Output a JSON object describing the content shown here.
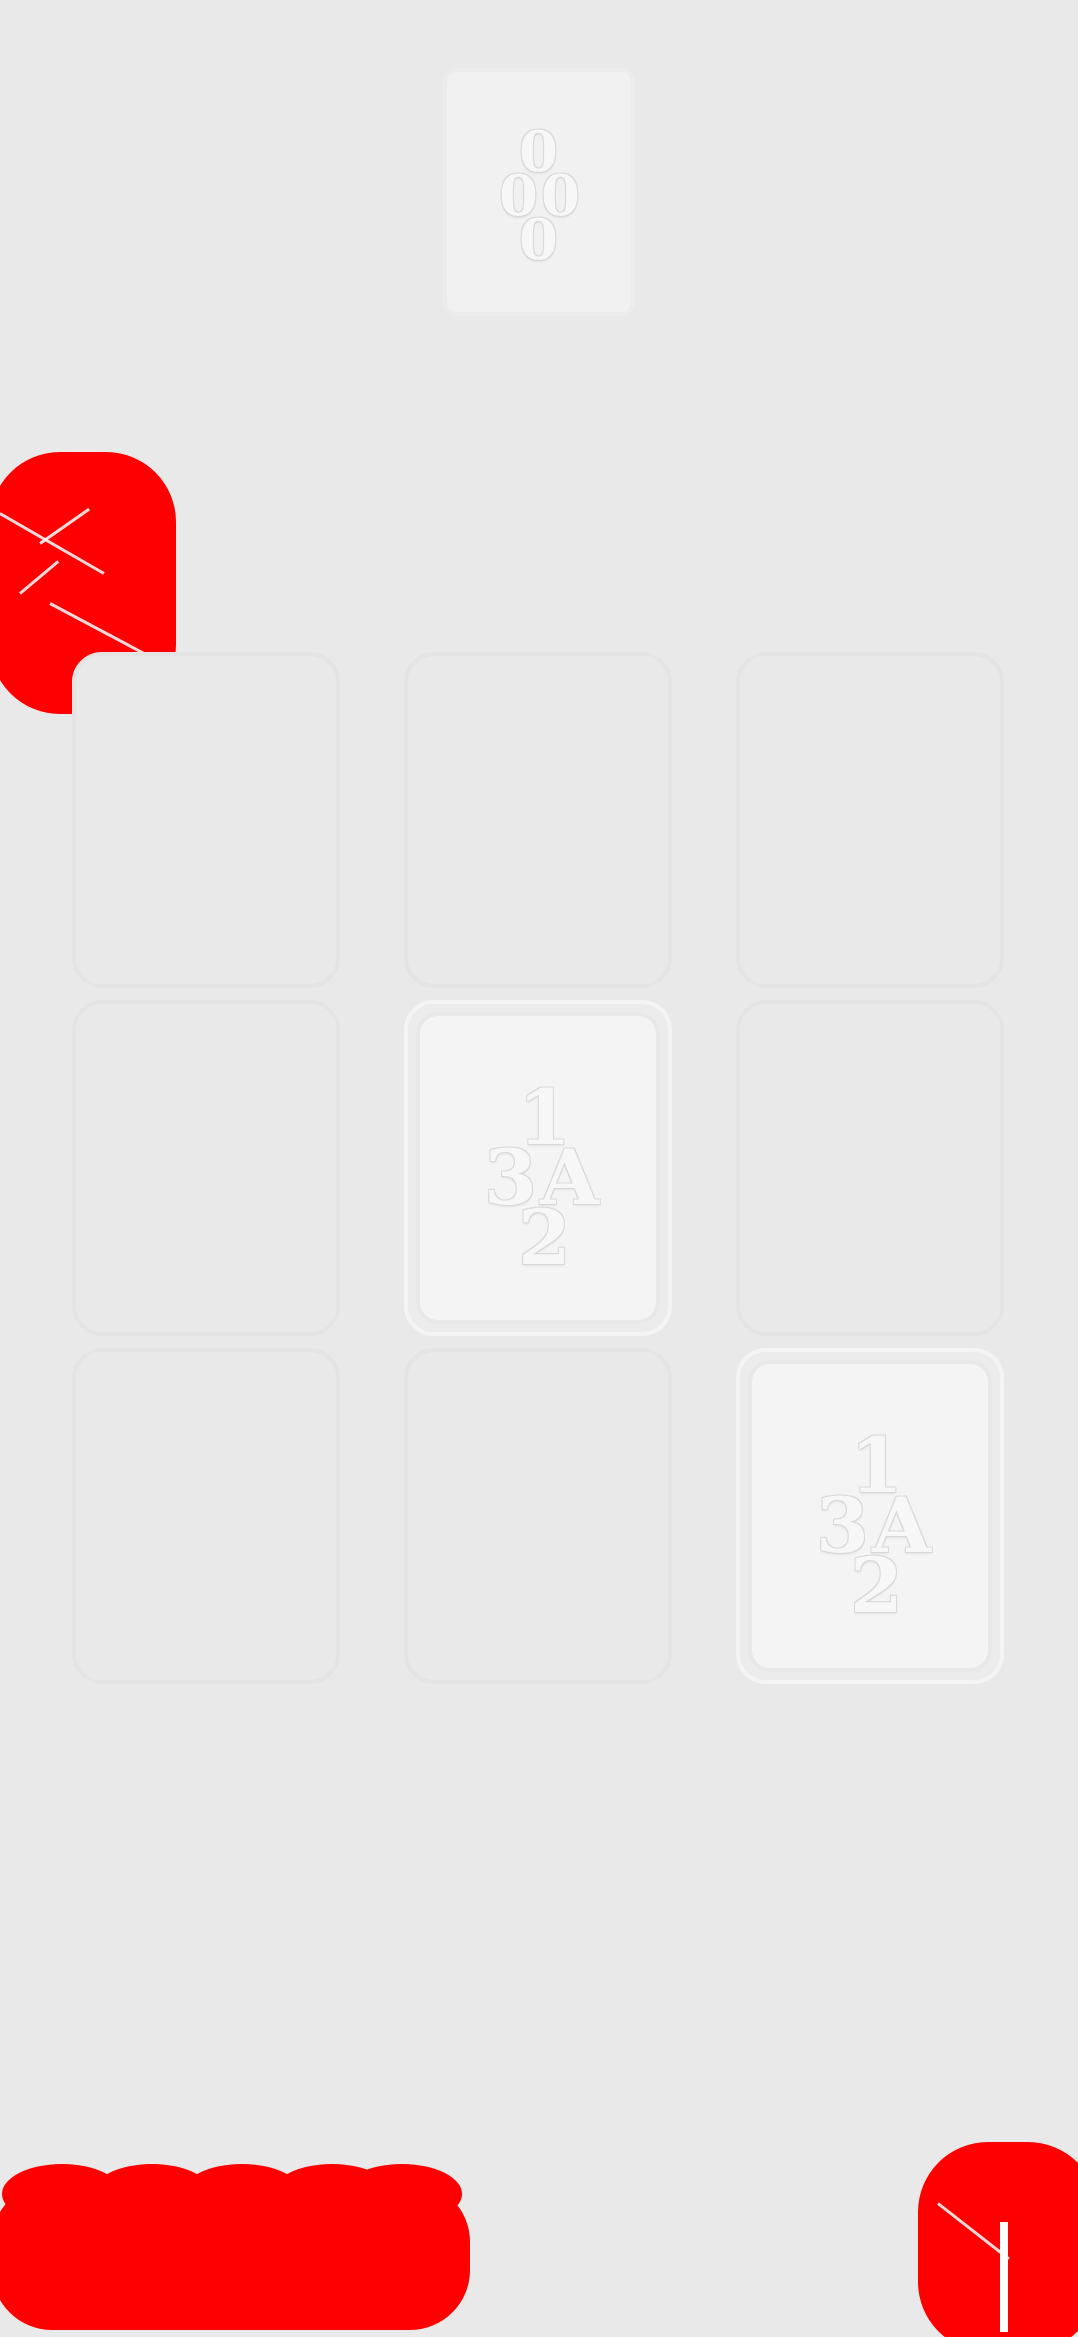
{
  "next_tile": {
    "top": "0",
    "left": "0",
    "right": "0",
    "bottom": "0"
  },
  "board": {
    "rows": 3,
    "cols": 3,
    "cells": [
      {
        "row": 0,
        "col": 0,
        "filled": false
      },
      {
        "row": 0,
        "col": 1,
        "filled": false
      },
      {
        "row": 0,
        "col": 2,
        "filled": false
      },
      {
        "row": 1,
        "col": 0,
        "filled": false
      },
      {
        "row": 1,
        "col": 1,
        "filled": true,
        "top": "1",
        "left": "3",
        "right": "A",
        "bottom": "2"
      },
      {
        "row": 1,
        "col": 2,
        "filled": false
      },
      {
        "row": 2,
        "col": 0,
        "filled": false
      },
      {
        "row": 2,
        "col": 1,
        "filled": false
      },
      {
        "row": 2,
        "col": 2,
        "filled": true,
        "top": "1",
        "left": "3",
        "right": "A",
        "bottom": "2"
      }
    ]
  },
  "colors": {
    "background": "#e9e9e9",
    "overlay_red": "#ff0000",
    "card_face": "#f4f4f4"
  },
  "icons": {
    "menu": "menu-icon",
    "corner": "action-icon"
  }
}
